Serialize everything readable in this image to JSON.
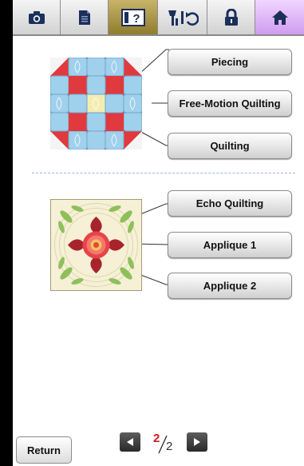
{
  "toolbar": {
    "buttons": [
      {
        "icon": "camera-icon",
        "active": false
      },
      {
        "icon": "document-icon",
        "active": false
      },
      {
        "icon": "help-icon",
        "label": "?",
        "active": true
      },
      {
        "icon": "thread-change-icon",
        "active": false
      },
      {
        "icon": "lock-icon",
        "active": false
      },
      {
        "icon": "home-icon",
        "active": false
      }
    ],
    "active_color": "#9c8836",
    "home_color": "#d8a6f2"
  },
  "categories": {
    "piecing": "Piecing",
    "free_motion_quilting": "Free-Motion Quilting",
    "quilting": "Quilting",
    "echo_quilting": "Echo Quilting",
    "applique_1": "Applique 1",
    "applique_2": "Applique 2"
  },
  "footer": {
    "return_label": "Return",
    "page_current": "2",
    "page_total": "2",
    "prev_icon": "triangle-left-icon",
    "next_icon": "triangle-right-icon"
  }
}
